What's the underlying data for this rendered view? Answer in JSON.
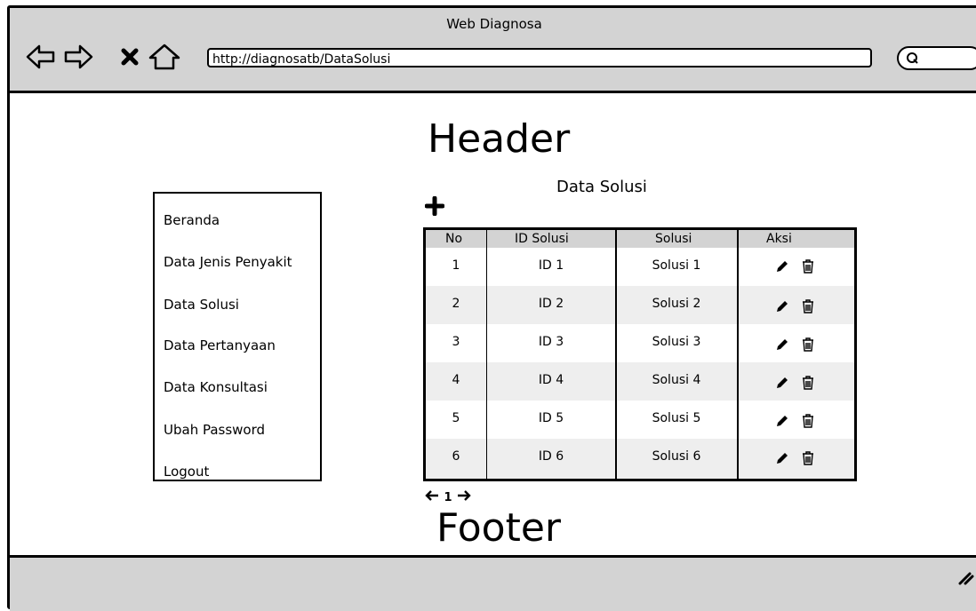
{
  "window": {
    "title": "Web Diagnosa",
    "url": "http://diagnosatb/DataSolusi"
  },
  "page": {
    "header": "Header",
    "footer": "Footer"
  },
  "sidebar": {
    "items": [
      {
        "label": "Beranda"
      },
      {
        "label": "Data Jenis Penyakit"
      },
      {
        "label": "Data Solusi"
      },
      {
        "label": "Data Pertanyaan"
      },
      {
        "label": "Data Konsultasi"
      },
      {
        "label": "Ubah Password"
      },
      {
        "label": "Logout"
      }
    ]
  },
  "main": {
    "title": "Data Solusi",
    "table": {
      "columns": [
        "No",
        "ID Solusi",
        "Solusi",
        "Aksi"
      ],
      "rows": [
        {
          "no": "1",
          "id": "ID 1",
          "solusi": "Solusi 1"
        },
        {
          "no": "2",
          "id": "ID 2",
          "solusi": "Solusi 2"
        },
        {
          "no": "3",
          "id": "ID 3",
          "solusi": "Solusi 3"
        },
        {
          "no": "4",
          "id": "ID 4",
          "solusi": "Solusi 4"
        },
        {
          "no": "5",
          "id": "ID 5",
          "solusi": "Solusi 5"
        },
        {
          "no": "6",
          "id": "ID 6",
          "solusi": "Solusi 6"
        }
      ]
    },
    "pagination": {
      "current": "1"
    }
  },
  "icons": {
    "nav": [
      "back-arrow-icon",
      "forward-arrow-icon",
      "close-icon",
      "home-icon"
    ],
    "search": "search-icon",
    "add": "plus-icon",
    "edit": "pencil-icon",
    "delete": "trash-icon"
  },
  "colors": {
    "chrome": "#d3d3d3",
    "stripe": "#eeeeee"
  }
}
